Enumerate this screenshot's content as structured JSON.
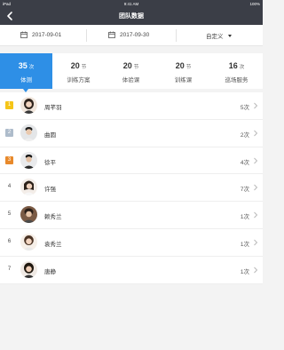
{
  "status_bar": {
    "carrier": "iPad",
    "time": "9:41 AM",
    "battery": "100%"
  },
  "nav": {
    "title": "团队数据",
    "back_icon": "chevron-left-icon"
  },
  "filter": {
    "start_date": "2017-09-01",
    "end_date": "2017-09-30",
    "range_select": "自定义"
  },
  "tabs": [
    {
      "value": "35",
      "unit": "次",
      "label": "体测",
      "active": true
    },
    {
      "value": "20",
      "unit": "节",
      "label": "训练方案",
      "active": false
    },
    {
      "value": "20",
      "unit": "节",
      "label": "体验课",
      "active": false
    },
    {
      "value": "20",
      "unit": "节",
      "label": "训练课",
      "active": false
    },
    {
      "value": "16",
      "unit": "次",
      "label": "巡场服务",
      "active": false
    }
  ],
  "ranking": [
    {
      "rank": "1",
      "name": "周芊羽",
      "count": "5次",
      "badge_color": "#f5c518"
    },
    {
      "rank": "2",
      "name": "曲圆",
      "count": "2次",
      "badge_color": "#aebccb"
    },
    {
      "rank": "3",
      "name": "徐平",
      "count": "4次",
      "badge_color": "#e8892b"
    },
    {
      "rank": "4",
      "name": "许强",
      "count": "7次",
      "badge_color": ""
    },
    {
      "rank": "5",
      "name": "赖秀兰",
      "count": "1次",
      "badge_color": ""
    },
    {
      "rank": "6",
      "name": "袁秀兰",
      "count": "1次",
      "badge_color": ""
    },
    {
      "rank": "7",
      "name": "唐静",
      "count": "1次",
      "badge_color": ""
    }
  ],
  "colors": {
    "nav_bg": "#3b3e47",
    "accent": "#2e8fe6"
  }
}
